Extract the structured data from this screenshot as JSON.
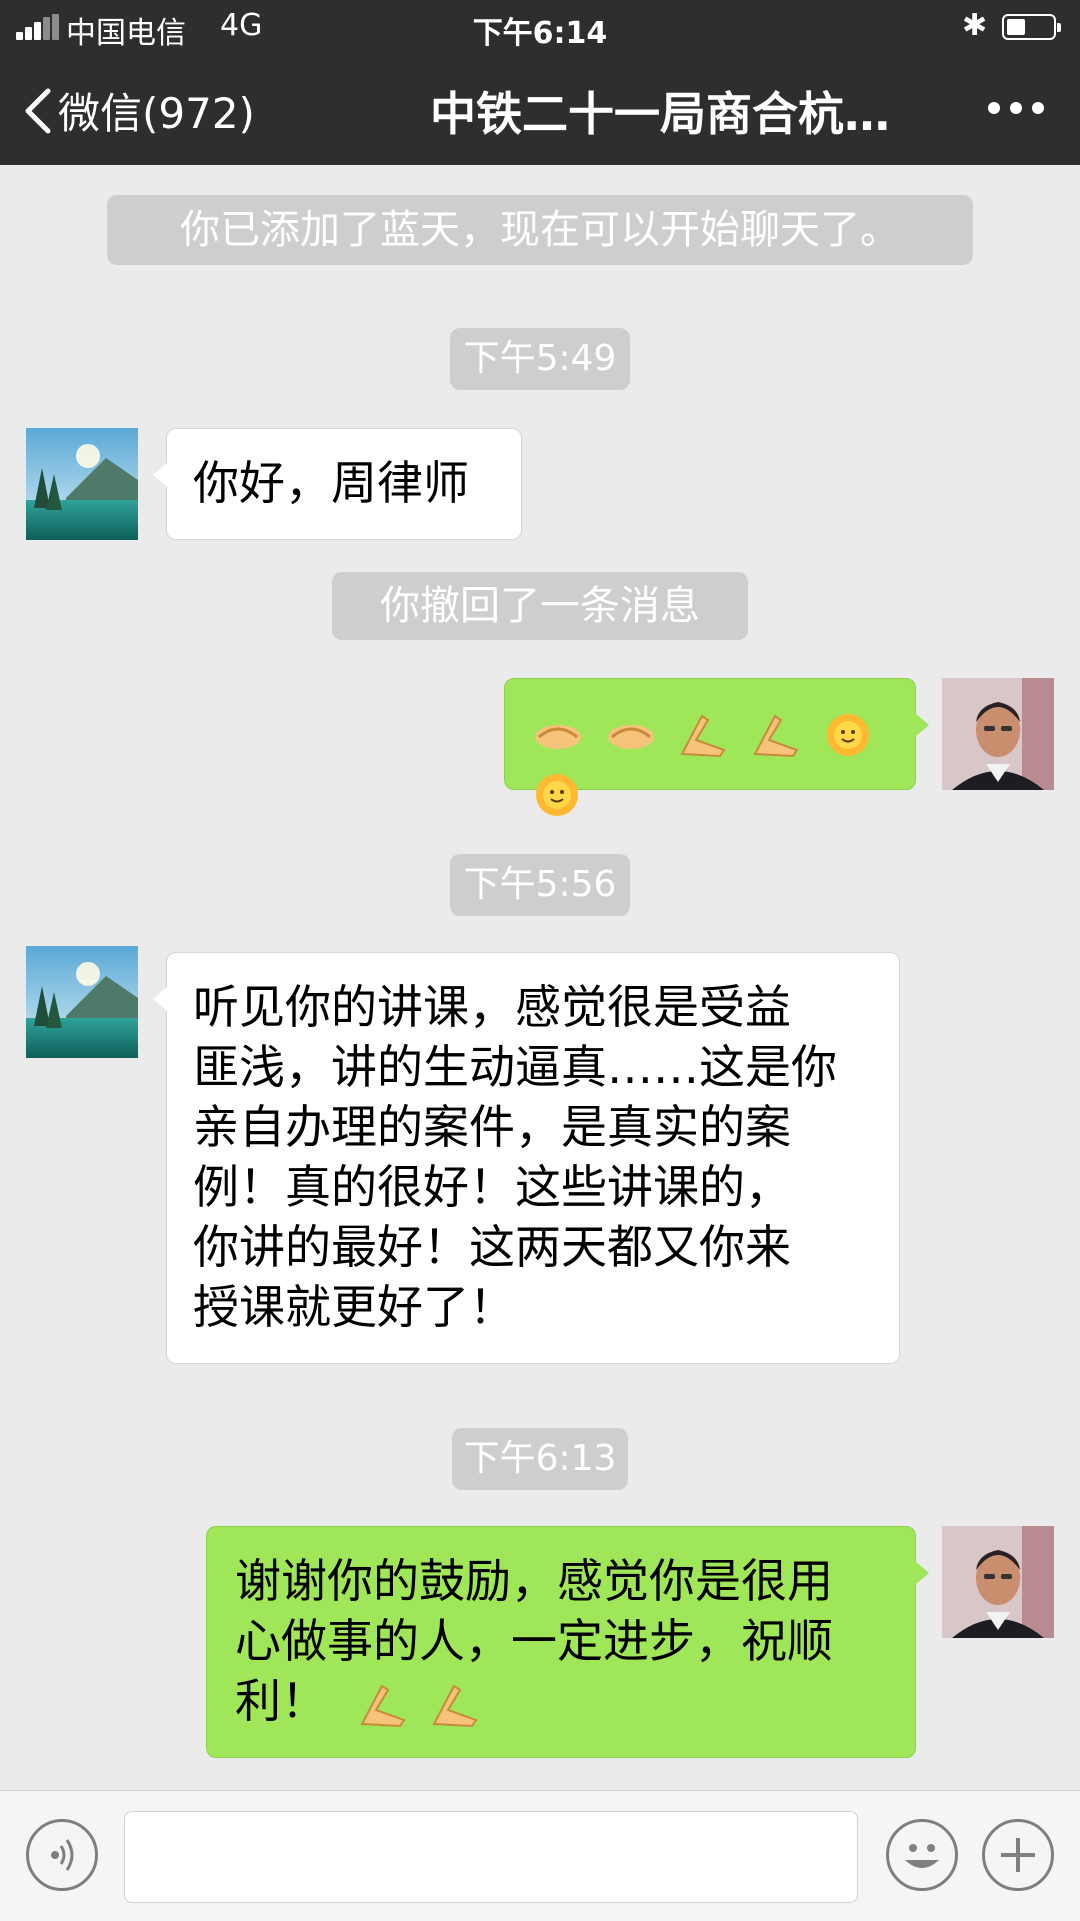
{
  "status_bar": {
    "carrier": "中国电信",
    "network": "4G",
    "time": "下午6:14"
  },
  "nav": {
    "back_label": "微信(972)",
    "title": "中铁二十一局商合杭…"
  },
  "messages": {
    "notice_added": "你已添加了蓝天，现在可以开始聊天了。",
    "time_1": "下午5:49",
    "msg_1": "你好，周律师",
    "notice_recalled": "你撤回了一条消息",
    "time_2": "下午5:56",
    "msg_3_lines": [
      "听见你的讲课，感觉很是受益",
      "匪浅，讲的生动逼真……这是你",
      "亲自办理的案件，是真实的案",
      "例！真的很好！这些讲课的，",
      "你讲的最好！这两天都又你来",
      "授课就更好了！"
    ],
    "time_3": "下午6:13",
    "msg_4_lines": [
      "谢谢你的鼓励，感觉你是很用",
      "心做事的人，一定进步，祝顺",
      "利！"
    ]
  },
  "input": {
    "text": "",
    "placeholder": ""
  },
  "icons": {
    "back": "chevron-left-icon",
    "more": "more-dots-icon",
    "voice": "voice-icon",
    "emoji": "emoji-face-icon",
    "add": "plus-icon",
    "emoji_handshake": "handshake-emoji",
    "emoji_ok": "ok-hand-emoji",
    "emoji_sun": "sun-emoji"
  },
  "colors": {
    "header_bg": "#2e2e31",
    "chat_bg": "#ebebeb",
    "bubble_self": "#9fe658",
    "bubble_other": "#ffffff",
    "system_notice": "#cecece"
  }
}
